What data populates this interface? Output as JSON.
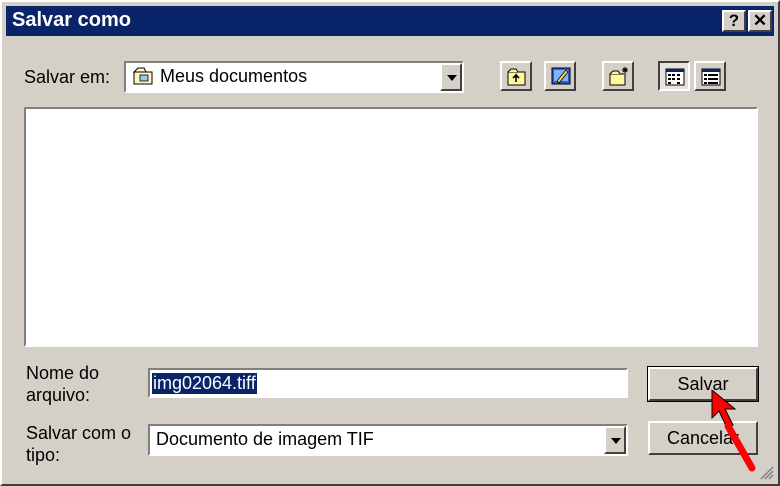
{
  "window": {
    "title": "Salvar como",
    "help_label": "?",
    "close_label": "✕"
  },
  "location": {
    "label": "Salvar em:",
    "value": "Meus documentos"
  },
  "toolbar": [
    {
      "name": "up-one-level-icon"
    },
    {
      "name": "desktop-icon"
    },
    {
      "name": "new-folder-icon"
    },
    {
      "name": "list-view-icon"
    },
    {
      "name": "details-view-icon"
    }
  ],
  "filename": {
    "label_line1": "Nome do",
    "label_line2": "arquivo:",
    "value": "img02064.tiff"
  },
  "filetype": {
    "label_line1": "Salvar com o",
    "label_line2": "tipo:",
    "value": "Documento de imagem TIF"
  },
  "buttons": {
    "save": "Salvar",
    "cancel": "Cancelar"
  },
  "colors": {
    "titlebar": "#0a246a",
    "face": "#d4d0c8",
    "cursor": "#ff0000"
  }
}
